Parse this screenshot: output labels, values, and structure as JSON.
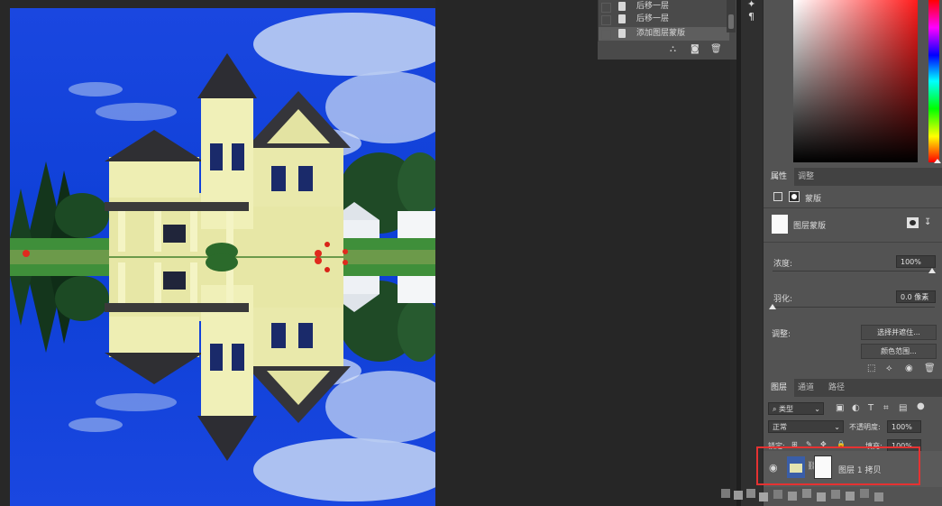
{
  "history": {
    "items": [
      {
        "label": "后移一层",
        "selected": false
      },
      {
        "label": "后移一层",
        "selected": false
      },
      {
        "label": "添加图层蒙版",
        "selected": true
      }
    ]
  },
  "properties": {
    "tabs": [
      "属性",
      "调整"
    ],
    "mask_type_label": "蒙版",
    "layer_mask_label": "图层蒙版",
    "density_label": "浓度:",
    "density_value": "100%",
    "density": 1.0,
    "feather_label": "羽化:",
    "feather_value": "0.0 像素",
    "feather": 0.0,
    "adjust_label": "调整:",
    "select_and_mask_button": "选择并遮住...",
    "color_range_button": "颜色范围..."
  },
  "layers": {
    "tabs": [
      "图层",
      "通道",
      "路径"
    ],
    "filter_kind": "类型",
    "blend_mode": "正常",
    "opacity_label": "不透明度:",
    "opacity_value": "100%",
    "lock_label": "锁定:",
    "fill_label": "填充:",
    "fill_value": "100%",
    "layer_name": "图层 1 拷贝"
  },
  "icons": {
    "eye": "eye-icon",
    "link": "link-icon",
    "search": "search-icon",
    "trash": "trash-icon",
    "camera": "camera-icon"
  },
  "colors": {
    "annotation": "#e63232",
    "panel_bg": "#535353",
    "workspace": "#282828"
  }
}
